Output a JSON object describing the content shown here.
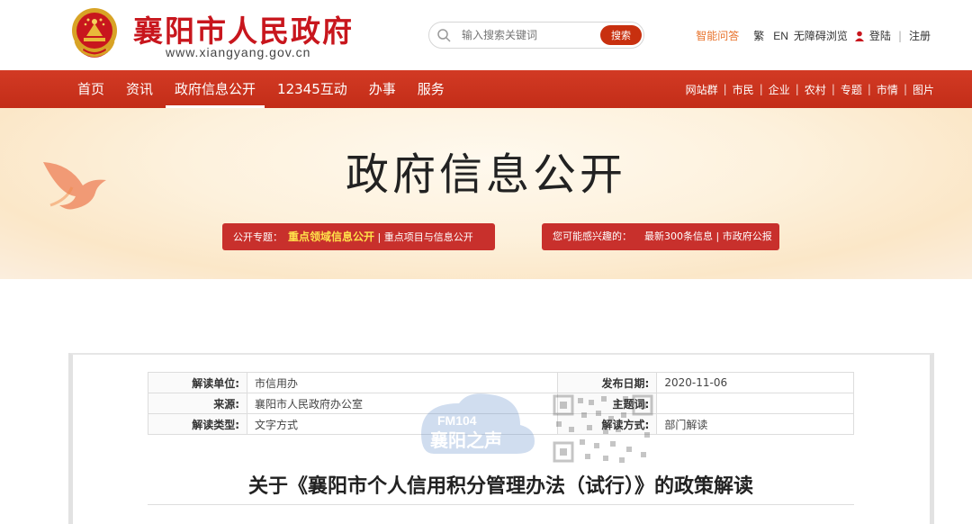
{
  "header": {
    "site_name": "襄阳市人民政府",
    "site_url": "www.xiangyang.gov.cn",
    "search": {
      "placeholder": "输入搜索关键词",
      "button": "搜索"
    },
    "links": {
      "ai_qa": "智能问答",
      "traditional": "繁",
      "english": "EN",
      "accessibility": "无障碍浏览",
      "login": "登陆",
      "register": "注册"
    }
  },
  "nav": {
    "items": [
      "首页",
      "资讯",
      "政府信息公开",
      "12345互动",
      "办事",
      "服务"
    ],
    "active_index": 2,
    "right_links": [
      "网站群",
      "市民",
      "企业",
      "农村",
      "专题",
      "市情",
      "图片"
    ]
  },
  "banner": {
    "title": "政府信息公开",
    "topic_label": "公开专题：",
    "topic_highlight": "重点领域信息公开",
    "topic_rest": "| 重点项目与信息公开",
    "interest_label": "您可能感兴趣的：",
    "interest_links": "最新300条信息 | 市政府公报"
  },
  "meta": {
    "rows": [
      {
        "k1": "解读单位:",
        "v1": "市信用办",
        "k2": "发布日期:",
        "v2": "2020-11-06"
      },
      {
        "k1": "来源:",
        "v1": "襄阳市人民政府办公室",
        "k2": "主题词:",
        "v2": ""
      },
      {
        "k1": "解读类型:",
        "v1": "文字方式",
        "k2": "解读方式:",
        "v2": "部门解读"
      }
    ]
  },
  "watermark": {
    "line1": "FM104",
    "line2": "襄阳之声"
  },
  "article": {
    "title": "关于《襄阳市个人信用积分管理办法（试行）》的政策解读"
  },
  "colors": {
    "brand_red": "#c8161d",
    "nav_red": "#c9302c",
    "accent_orange": "#e8722b",
    "highlight_yellow": "#ffe14a"
  }
}
